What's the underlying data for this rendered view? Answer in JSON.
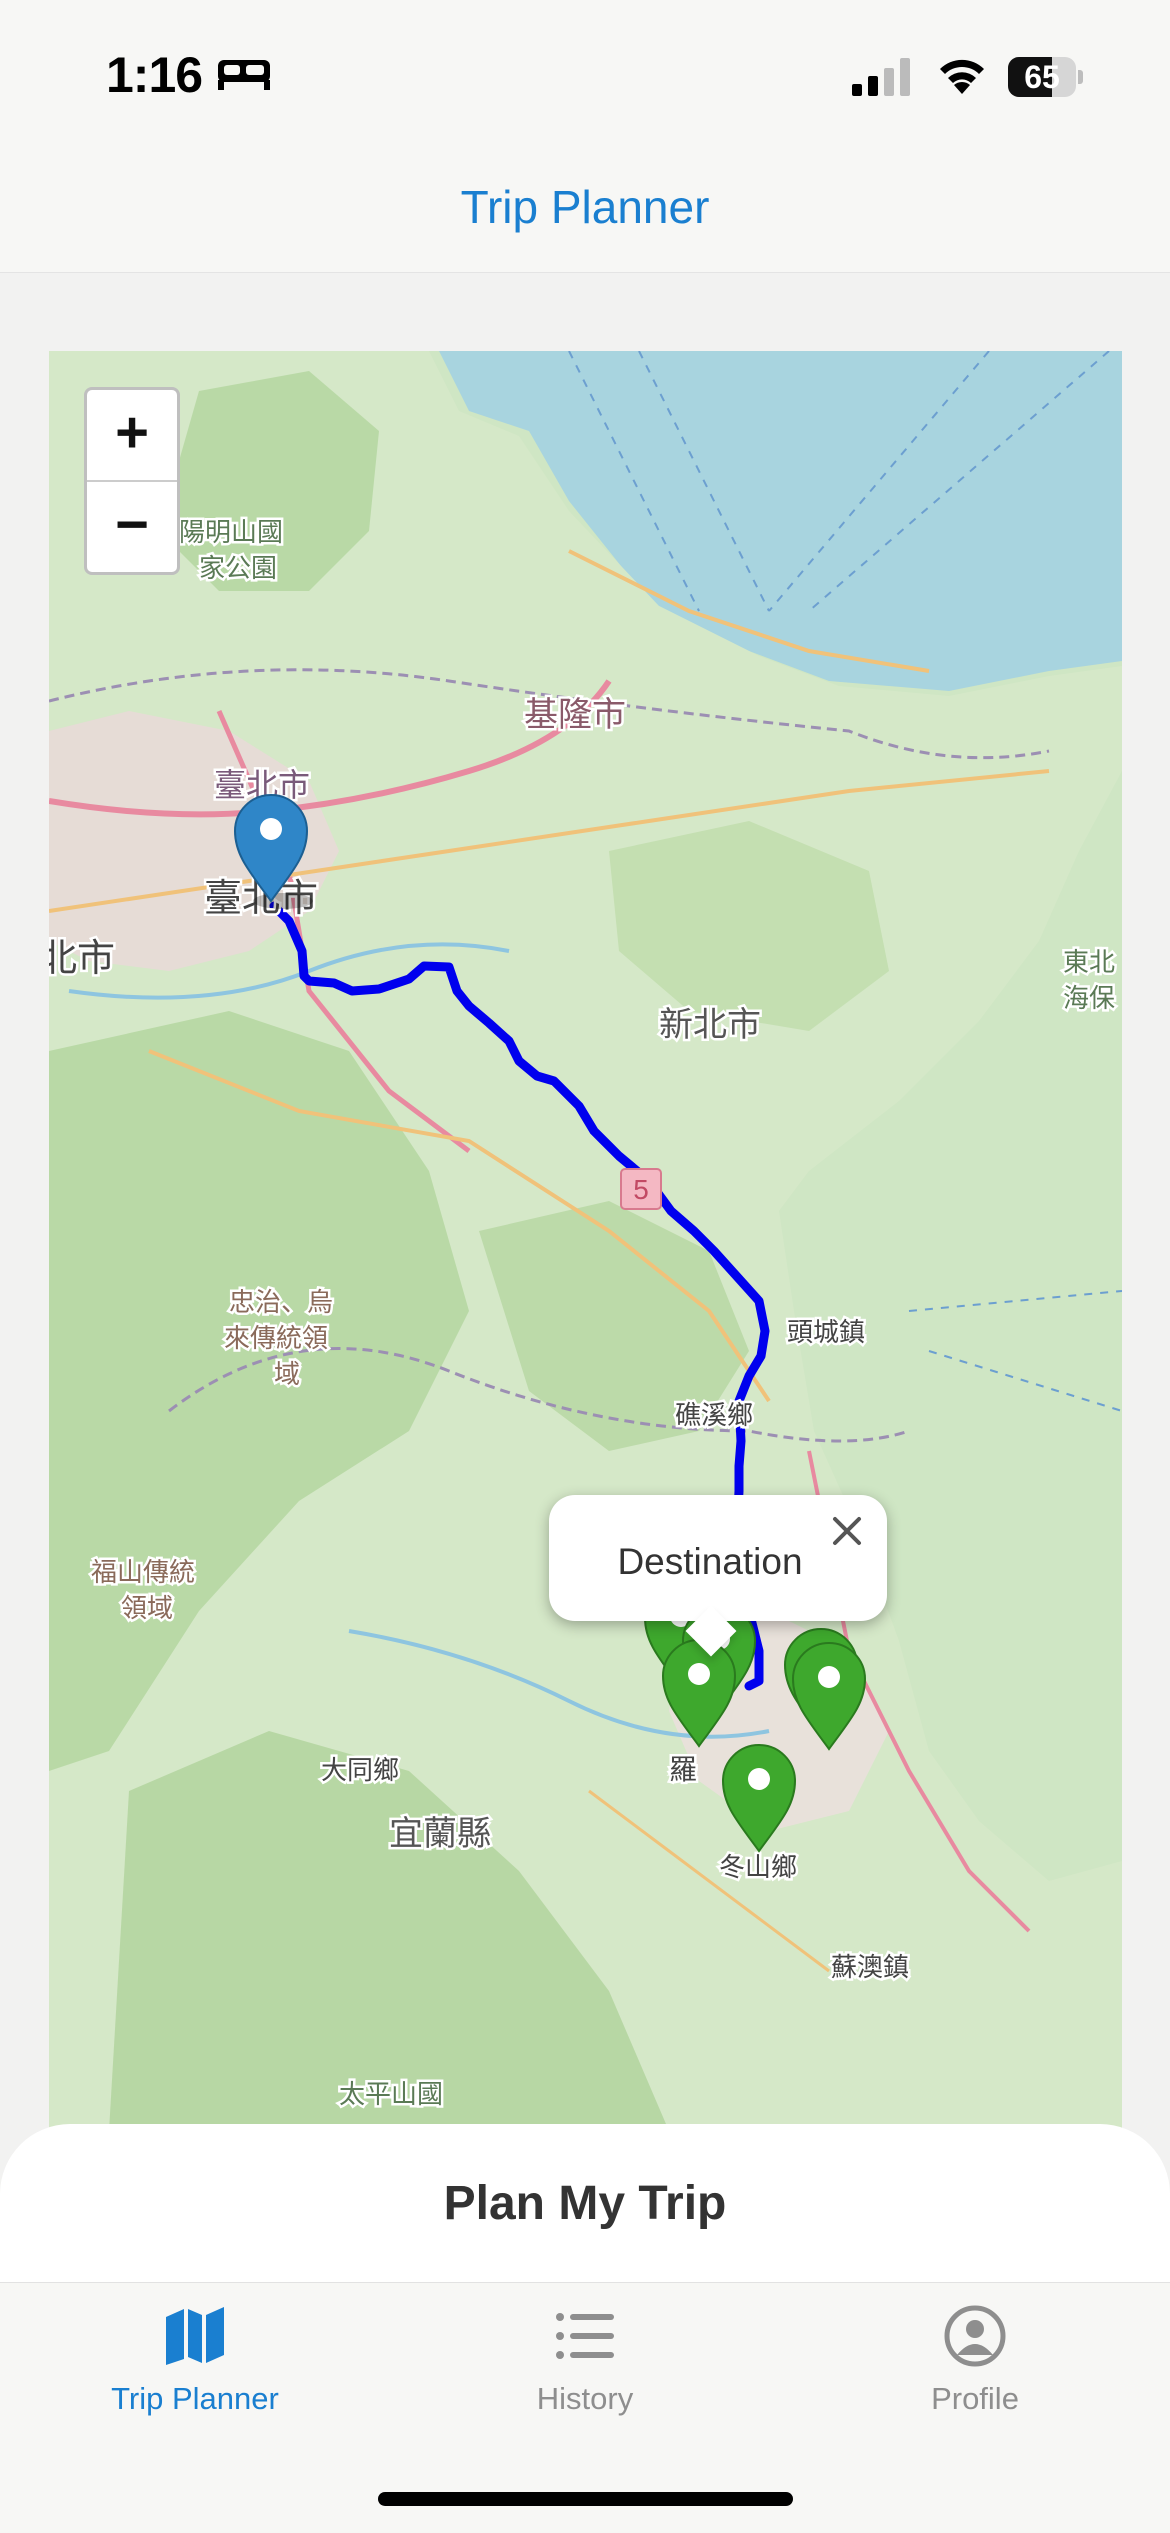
{
  "status": {
    "time": "1:16",
    "battery": "65",
    "battery_level": 0.65,
    "icons": [
      "bed-icon",
      "cellular-signal-icon",
      "wifi-icon",
      "battery-icon"
    ]
  },
  "header": {
    "title": "Trip Planner"
  },
  "map": {
    "zoom_in": "+",
    "zoom_out": "−",
    "route_color": "#0000ee",
    "origin_marker_color": "#2f86c8",
    "destination_marker_color": "#3ea82d",
    "popup": {
      "text": "Destination",
      "close": "×"
    },
    "labels": {
      "yangmingshan_1": "陽明山國",
      "yangmingshan_2": "家公園",
      "taipei_top": "臺北市",
      "taipei_main": "臺北市",
      "newtaipei_left": "北市",
      "keelung": "基隆市",
      "newtaipei": "新北市",
      "toucheng": "頭城鎮",
      "jiaoxi": "礁溪鄉",
      "dongbei_1": "東北",
      "dongbei_2": "海保",
      "zhongzhi_1": "忠治、烏",
      "zhongzhi_2": "來傳統領",
      "zhongzhi_3": "域",
      "fushan_1": "福山傳統",
      "fushan_2": "領域",
      "datong": "大同鄉",
      "yilan": "宜蘭縣",
      "dongshan": "冬山鄉",
      "suao": "蘇澳鎮",
      "taipingshan": "太平山國",
      "luodong": "羅",
      "route_badge": "5"
    }
  },
  "sheet": {
    "title": "Plan My Trip"
  },
  "tabs": [
    {
      "label": "Trip Planner",
      "icon": "map-icon",
      "active": true
    },
    {
      "label": "History",
      "icon": "list-icon",
      "active": false
    },
    {
      "label": "Profile",
      "icon": "person-circle-icon",
      "active": false
    }
  ],
  "colors": {
    "accent": "#1a7fd0",
    "inactive": "#8e8e8e"
  }
}
